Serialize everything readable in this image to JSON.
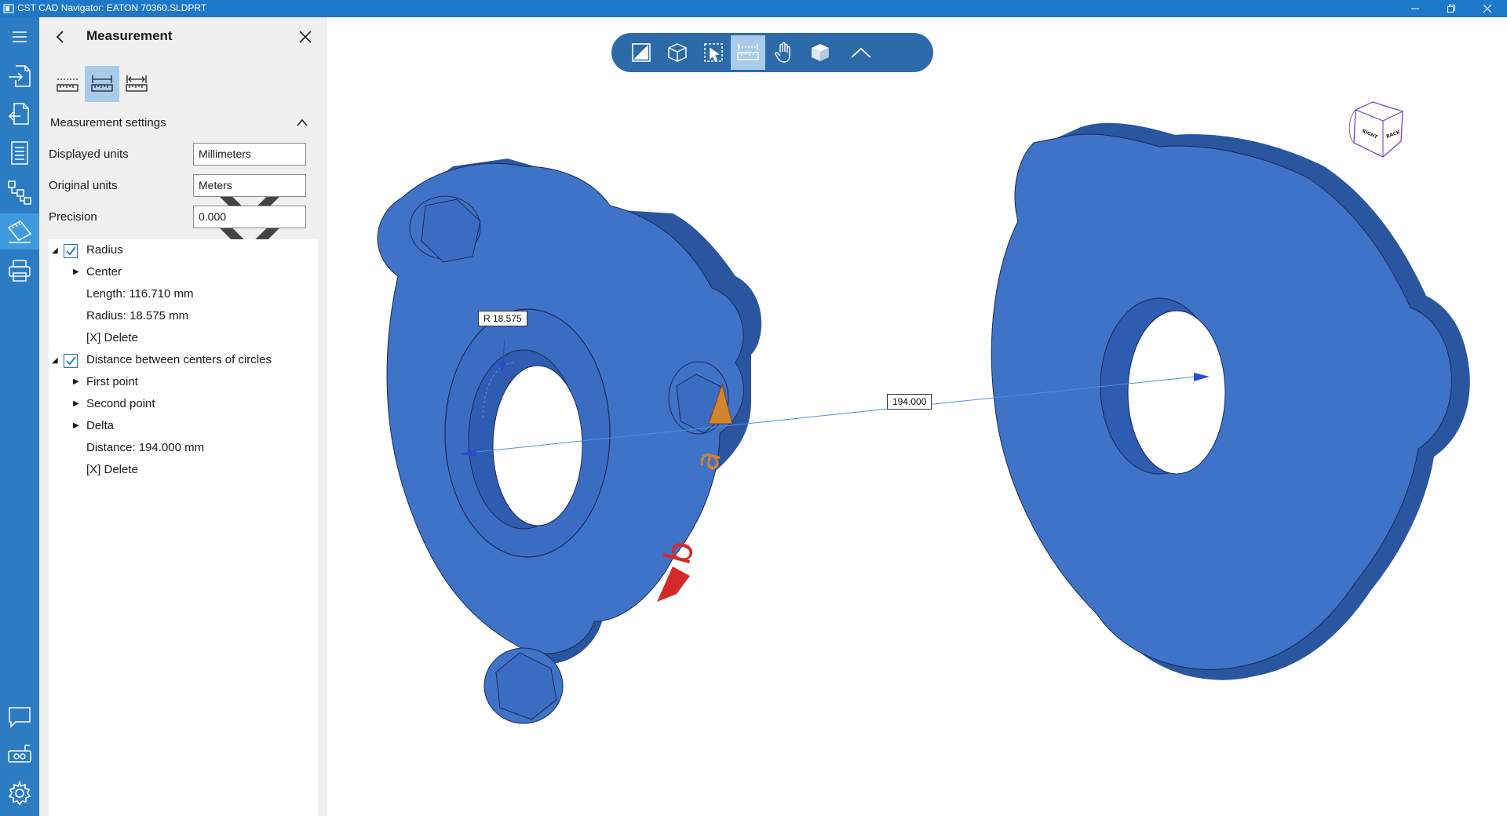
{
  "window": {
    "title": "CST CAD Navigator: EATON 70360.SLDPRT",
    "controls": [
      "minimize-icon",
      "restore-icon",
      "close-icon"
    ]
  },
  "sidebar_icons": [
    "menu-icon",
    "import-icon",
    "export-icon",
    "document-icon",
    "tree-structure-icon",
    "measurement-icon",
    "print-icon",
    "comment-icon",
    "video-recorder-icon",
    "settings-icon"
  ],
  "panel": {
    "title": "Measurement",
    "tools": [
      "ruler-point-icon",
      "ruler-edge-icon",
      "ruler-distance-icon"
    ],
    "settings_header": "Measurement settings",
    "settings": [
      {
        "label": "Displayed units",
        "value": "Millimeters"
      },
      {
        "label": "Original units",
        "value": "Meters"
      },
      {
        "label": "Precision",
        "value": "0.000"
      }
    ],
    "tree": {
      "radius": {
        "label": "Radius",
        "checked": true,
        "center": "Center",
        "length": "Length: 116.710 mm",
        "radius": "Radius: 18.575 mm",
        "delete": "[X] Delete"
      },
      "distance": {
        "label": "Distance between centers of circles",
        "checked": true,
        "first": "First point",
        "second": "Second point",
        "delta": "Delta",
        "distance": "Distance: 194.000 mm",
        "delete": "[X] Delete"
      }
    }
  },
  "toolbar": {
    "buttons": [
      "section-view-icon",
      "view-cube-icon",
      "select-icon",
      "measure-icon",
      "pan-hand-icon",
      "shaded-cube-icon",
      "collapse-chevron-icon"
    ],
    "active": "measure-icon"
  },
  "viewport": {
    "radius_label": "R 18.575",
    "distance_label": "194.000",
    "cube_faces": [
      "RIGHT",
      "BACK"
    ],
    "part_marks": [
      "a",
      "b"
    ],
    "colors": {
      "part": "#3f73c8",
      "part_dark": "#2a56a0",
      "mark_a": "#d4842e",
      "mark_b": "#d62a2a",
      "accent": "#2c7cc4"
    }
  }
}
